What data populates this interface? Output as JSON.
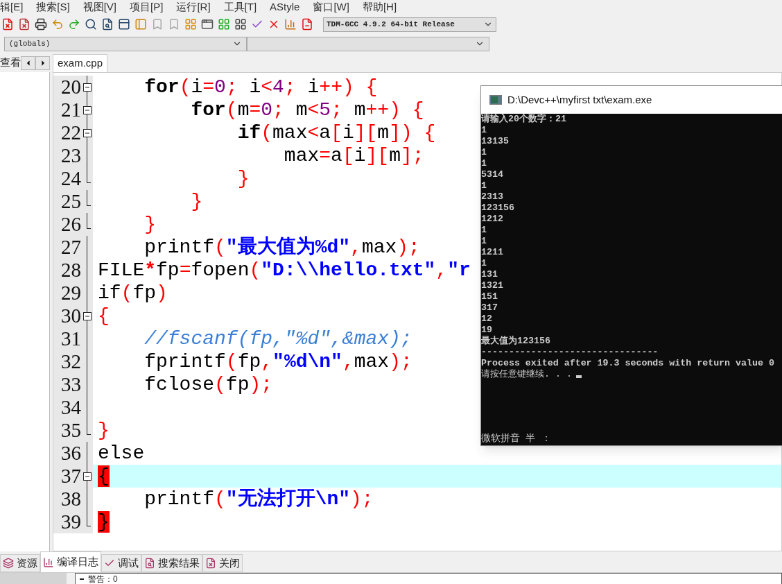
{
  "menu": [
    "辑[E]",
    "搜索[S]",
    "视图[V]",
    "项目[P]",
    "运行[R]",
    "工具[T]",
    "AStyle",
    "窗口[W]",
    "帮助[H]"
  ],
  "toolbar": {
    "compiler": "TDM-GCC 4.9.2 64-bit Release",
    "scope": "(globals)"
  },
  "left_panel": {
    "tab": "查看"
  },
  "editor": {
    "tab": "exam.cpp",
    "lines": [
      {
        "number": "20",
        "kind": "fold_start",
        "current": false,
        "tokens": [
          {
            "t": "    for",
            "kind": "kw"
          },
          {
            "t": "(",
            "kind": "op"
          },
          {
            "t": "i",
            "kind": "id"
          },
          {
            "t": "=",
            "kind": "op"
          },
          {
            "t": "0",
            "kind": "num"
          },
          {
            "t": ";",
            "kind": "op"
          },
          {
            "t": " i",
            "kind": "id"
          },
          {
            "t": "<",
            "kind": "op"
          },
          {
            "t": "4",
            "kind": "num"
          },
          {
            "t": ";",
            "kind": "op"
          },
          {
            "t": " i",
            "kind": "id"
          },
          {
            "t": "++",
            "kind": "op"
          },
          {
            "t": ")",
            "kind": "op"
          },
          {
            "t": " {",
            "kind": "op"
          }
        ]
      },
      {
        "number": "21",
        "kind": "fold_start",
        "current": false,
        "tokens": [
          {
            "t": "        for",
            "kind": "kw"
          },
          {
            "t": "(",
            "kind": "op"
          },
          {
            "t": "m",
            "kind": "id"
          },
          {
            "t": "=",
            "kind": "op"
          },
          {
            "t": "0",
            "kind": "num"
          },
          {
            "t": ";",
            "kind": "op"
          },
          {
            "t": " m",
            "kind": "id"
          },
          {
            "t": "<",
            "kind": "op"
          },
          {
            "t": "5",
            "kind": "num"
          },
          {
            "t": ";",
            "kind": "op"
          },
          {
            "t": " m",
            "kind": "id"
          },
          {
            "t": "++",
            "kind": "op"
          },
          {
            "t": ")",
            "kind": "op"
          },
          {
            "t": " {",
            "kind": "op"
          }
        ]
      },
      {
        "number": "22",
        "kind": "fold_start",
        "current": false,
        "tokens": [
          {
            "t": "            if",
            "kind": "kw"
          },
          {
            "t": "(",
            "kind": "op"
          },
          {
            "t": "max",
            "kind": "id"
          },
          {
            "t": "<",
            "kind": "op"
          },
          {
            "t": "a",
            "kind": "id"
          },
          {
            "t": "[",
            "kind": "op"
          },
          {
            "t": "i",
            "kind": "id"
          },
          {
            "t": "][",
            "kind": "op"
          },
          {
            "t": "m",
            "kind": "id"
          },
          {
            "t": "])",
            "kind": "op"
          },
          {
            "t": " {",
            "kind": "op"
          }
        ]
      },
      {
        "number": "23",
        "kind": "fold_body",
        "current": false,
        "tokens": [
          {
            "t": "                max",
            "kind": "id"
          },
          {
            "t": "=",
            "kind": "op"
          },
          {
            "t": "a",
            "kind": "id"
          },
          {
            "t": "[",
            "kind": "op"
          },
          {
            "t": "i",
            "kind": "id"
          },
          {
            "t": "][",
            "kind": "op"
          },
          {
            "t": "m",
            "kind": "id"
          },
          {
            "t": "];",
            "kind": "op"
          }
        ]
      },
      {
        "number": "24",
        "kind": "fold_end",
        "current": false,
        "tokens": [
          {
            "t": "            }",
            "kind": "op"
          }
        ]
      },
      {
        "number": "25",
        "kind": "fold_end",
        "current": false,
        "tokens": [
          {
            "t": "        }",
            "kind": "op"
          }
        ]
      },
      {
        "number": "26",
        "kind": "fold_end",
        "current": false,
        "tokens": [
          {
            "t": "    }",
            "kind": "op"
          }
        ]
      },
      {
        "number": "27",
        "kind": "fold_body",
        "current": false,
        "tokens": [
          {
            "t": "    printf",
            "kind": "id"
          },
          {
            "t": "(",
            "kind": "op"
          },
          {
            "t": "\"最大值为%d\"",
            "kind": "str"
          },
          {
            "t": ",",
            "kind": "op"
          },
          {
            "t": "max",
            "kind": "id"
          },
          {
            "t": ");",
            "kind": "op"
          }
        ]
      },
      {
        "number": "28",
        "kind": "fold_body",
        "current": false,
        "tokens": [
          {
            "t": "FILE",
            "kind": "id"
          },
          {
            "t": "*",
            "kind": "opb"
          },
          {
            "t": "fp",
            "kind": "id"
          },
          {
            "t": "=",
            "kind": "op"
          },
          {
            "t": "fopen",
            "kind": "id"
          },
          {
            "t": "(",
            "kind": "op"
          },
          {
            "t": "\"D:\\\\hello.txt\"",
            "kind": "str"
          },
          {
            "t": ",",
            "kind": "op"
          },
          {
            "t": "\"r",
            "kind": "str"
          }
        ]
      },
      {
        "number": "29",
        "kind": "fold_body",
        "current": false,
        "tokens": [
          {
            "t": "if",
            "kind": "id"
          },
          {
            "t": "(",
            "kind": "op"
          },
          {
            "t": "fp",
            "kind": "id"
          },
          {
            "t": ")",
            "kind": "op"
          }
        ]
      },
      {
        "number": "30",
        "kind": "fold_start",
        "current": false,
        "tokens": [
          {
            "t": "{",
            "kind": "op"
          }
        ]
      },
      {
        "number": "31",
        "kind": "fold_body",
        "current": false,
        "tokens": [
          {
            "t": "    //fscanf(fp,\"%d\",&max);",
            "kind": "cmt"
          }
        ]
      },
      {
        "number": "32",
        "kind": "fold_body",
        "current": false,
        "tokens": [
          {
            "t": "    fprintf",
            "kind": "id"
          },
          {
            "t": "(",
            "kind": "op"
          },
          {
            "t": "fp",
            "kind": "id"
          },
          {
            "t": ",",
            "kind": "op"
          },
          {
            "t": "\"%d\\n\"",
            "kind": "str"
          },
          {
            "t": ",",
            "kind": "op"
          },
          {
            "t": "max",
            "kind": "id"
          },
          {
            "t": ");",
            "kind": "op"
          }
        ]
      },
      {
        "number": "33",
        "kind": "fold_body",
        "current": false,
        "tokens": [
          {
            "t": "    fclose",
            "kind": "id"
          },
          {
            "t": "(",
            "kind": "op"
          },
          {
            "t": "fp",
            "kind": "id"
          },
          {
            "t": ");",
            "kind": "op"
          }
        ]
      },
      {
        "number": "34",
        "kind": "fold_body",
        "current": false
      },
      {
        "number": "35",
        "kind": "fold_end",
        "current": false,
        "tokens": [
          {
            "t": "}",
            "kind": "op"
          }
        ]
      },
      {
        "number": "36",
        "kind": "fold_body",
        "current": false,
        "tokens": [
          {
            "t": "else",
            "kind": "id"
          }
        ]
      },
      {
        "number": "37",
        "kind": "fold_start",
        "current": true,
        "tokens": [
          {
            "t": "{",
            "kind": "match"
          }
        ]
      },
      {
        "number": "38",
        "kind": "fold_body",
        "current": false,
        "tokens": [
          {
            "t": "    printf",
            "kind": "id"
          },
          {
            "t": "(",
            "kind": "op"
          },
          {
            "t": "\"无法打开\\n\"",
            "kind": "str"
          },
          {
            "t": ");",
            "kind": "op"
          }
        ]
      },
      {
        "number": "39",
        "kind": "fold_end",
        "current": false,
        "tokens": [
          {
            "t": "}",
            "kind": "match"
          }
        ]
      }
    ]
  },
  "console": {
    "title": "D:\\Devc++\\myfirst txt\\exam.exe",
    "output": [
      "请输入20个数字：21",
      "1",
      "13135",
      "1",
      "1",
      "5314",
      "1",
      "2313",
      "123156",
      "1212",
      "1",
      "1",
      "1211",
      "1",
      "131",
      "1321",
      "151",
      "317",
      "12",
      "19",
      "最大值为123156",
      "--------------------------------"
    ],
    "exit_message": "Process exited after 19.3 seconds with return value 0",
    "prompt": "请按任意键继续. . .",
    "ime_status": "微软拼音 半 ："
  },
  "bottom_tabs": [
    {
      "label": "资源",
      "selected": false
    },
    {
      "label": "编译日志",
      "selected": true
    },
    {
      "label": "调试",
      "selected": false
    },
    {
      "label": "搜索结果",
      "selected": false
    },
    {
      "label": "关闭",
      "selected": false
    }
  ],
  "log": {
    "line": "警告：0"
  }
}
